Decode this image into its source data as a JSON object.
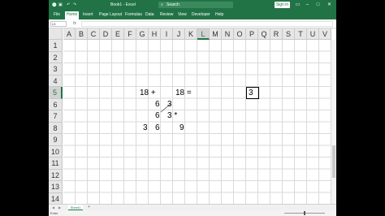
{
  "titlebar": {
    "title": "Book1 - Excel",
    "search_placeholder": "Search",
    "sign_in": "Sign in",
    "quick_access": [
      "AutoSave",
      "Save",
      "Undo",
      "Redo"
    ],
    "window_buttons": [
      "minimize",
      "maximize",
      "close"
    ]
  },
  "ribbon": {
    "tabs": [
      "File",
      "Home",
      "Insert",
      "Page Layout",
      "Formulas",
      "Data",
      "Review",
      "View",
      "Developer",
      "Help"
    ],
    "active_tab": "Home"
  },
  "formula_bar": {
    "name_box": "L5",
    "fx": "fx",
    "content": ""
  },
  "columns": [
    "A",
    "B",
    "C",
    "D",
    "E",
    "F",
    "G",
    "H",
    "I",
    "J",
    "K",
    "L",
    "M",
    "N",
    "O",
    "P",
    "Q",
    "R",
    "S",
    "T",
    "U",
    "V"
  ],
  "rows": [
    "1",
    "2",
    "3",
    "4",
    "5",
    "6",
    "7",
    "8",
    "9",
    "10",
    "11",
    "12",
    "13",
    "14"
  ],
  "selected_column": "L",
  "selected_row": "5",
  "cells": {
    "g5": "18 +",
    "j5": "18 =",
    "l5": "3",
    "g6": "6",
    "h6": "3",
    "g7": "6",
    "h7": "3 *",
    "f8": "3",
    "g8": "6",
    "i8": "9"
  },
  "sheets": {
    "active": "Sheet1",
    "add": "+"
  },
  "status": {
    "text": "Enter"
  },
  "colors": {
    "excel_green": "#217346",
    "grid": "#dadada",
    "header": "#e6e6e6"
  }
}
